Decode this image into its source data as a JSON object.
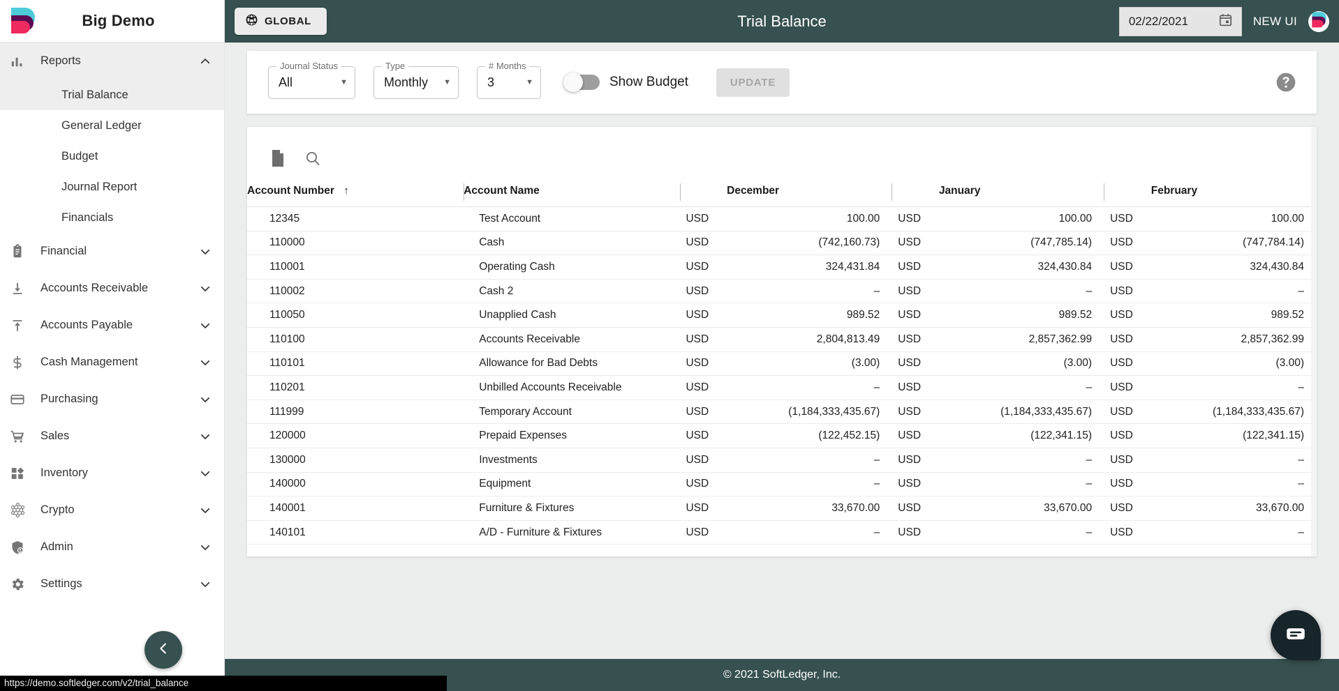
{
  "brand": {
    "title": "Big Demo",
    "logo_icon": "softledger-logo"
  },
  "sidebar": {
    "reports": {
      "label": "Reports",
      "icon": "bar-chart-icon",
      "chevron": "chevron-up-icon",
      "children": [
        {
          "label": "Trial Balance",
          "selected": true
        },
        {
          "label": "General Ledger",
          "selected": false
        },
        {
          "label": "Budget",
          "selected": false
        },
        {
          "label": "Journal Report",
          "selected": false
        },
        {
          "label": "Financials",
          "selected": false
        }
      ]
    },
    "items": [
      {
        "label": "Financial",
        "icon": "clipboard-icon"
      },
      {
        "label": "Accounts Receivable",
        "icon": "download-arrow-icon"
      },
      {
        "label": "Accounts Payable",
        "icon": "upload-arrow-icon"
      },
      {
        "label": "Cash Management",
        "icon": "dollar-sign-icon"
      },
      {
        "label": "Purchasing",
        "icon": "credit-card-icon"
      },
      {
        "label": "Sales",
        "icon": "shopping-cart-icon"
      },
      {
        "label": "Inventory",
        "icon": "grid-blocks-icon"
      },
      {
        "label": "Crypto",
        "icon": "crypto-network-icon"
      },
      {
        "label": "Admin",
        "icon": "shield-user-icon"
      },
      {
        "label": "Settings",
        "icon": "gear-icon"
      }
    ],
    "collapse_icon": "chevron-left-icon"
  },
  "statusbar": {
    "url": "https://demo.softledger.com/v2/trial_balance"
  },
  "topbar": {
    "global_label": "GLOBAL",
    "global_icon": "globe-icon",
    "page_title": "Trial Balance",
    "date_value": "02/22/2021",
    "calendar_icon": "calendar-icon",
    "new_ui_label": "NEW UI",
    "avatar_icon": "user-avatar-logo"
  },
  "filters": {
    "journal_status": {
      "legend": "Journal Status",
      "value": "All",
      "caret": "caret-down-icon"
    },
    "type": {
      "legend": "Type",
      "value": "Monthly",
      "caret": "caret-down-icon"
    },
    "months": {
      "legend": "# Months",
      "value": "3",
      "caret": "caret-down-icon"
    },
    "show_budget": {
      "label": "Show Budget",
      "on": false
    },
    "update_label": "UPDATE",
    "help_icon": "question-mark-circle-icon"
  },
  "table_tools": {
    "export_icon": "document-icon",
    "search_icon": "search-icon"
  },
  "table": {
    "headers": {
      "account_number": "Account Number",
      "account_name": "Account Name",
      "sort_arrow": "arrow-up-icon",
      "months": [
        "December",
        "January",
        "February"
      ]
    },
    "rows": [
      {
        "number": "12345",
        "name": "Test Account",
        "cur": "USD",
        "values": [
          "100.00",
          "100.00",
          "100.00"
        ]
      },
      {
        "number": "110000",
        "name": "Cash",
        "cur": "USD",
        "values": [
          "(742,160.73)",
          "(747,785.14)",
          "(747,784.14)"
        ]
      },
      {
        "number": "110001",
        "name": "Operating Cash",
        "cur": "USD",
        "values": [
          "324,431.84",
          "324,430.84",
          "324,430.84"
        ]
      },
      {
        "number": "110002",
        "name": "Cash 2",
        "cur": "USD",
        "values": [
          "–",
          "–",
          "–"
        ]
      },
      {
        "number": "110050",
        "name": "Unapplied Cash",
        "cur": "USD",
        "values": [
          "989.52",
          "989.52",
          "989.52"
        ]
      },
      {
        "number": "110100",
        "name": "Accounts Receivable",
        "cur": "USD",
        "values": [
          "2,804,813.49",
          "2,857,362.99",
          "2,857,362.99"
        ]
      },
      {
        "number": "110101",
        "name": "Allowance for Bad Debts",
        "cur": "USD",
        "values": [
          "(3.00)",
          "(3.00)",
          "(3.00)"
        ]
      },
      {
        "number": "110201",
        "name": "Unbilled Accounts Receivable",
        "cur": "USD",
        "values": [
          "–",
          "–",
          "–"
        ]
      },
      {
        "number": "111999",
        "name": "Temporary Account",
        "cur": "USD",
        "values": [
          "(1,184,333,435.67)",
          "(1,184,333,435.67)",
          "(1,184,333,435.67)"
        ]
      },
      {
        "number": "120000",
        "name": "Prepaid Expenses",
        "cur": "USD",
        "values": [
          "(122,452.15)",
          "(122,341.15)",
          "(122,341.15)"
        ]
      },
      {
        "number": "130000",
        "name": "Investments",
        "cur": "USD",
        "values": [
          "–",
          "–",
          "–"
        ]
      },
      {
        "number": "140000",
        "name": "Equipment",
        "cur": "USD",
        "values": [
          "–",
          "–",
          "–"
        ]
      },
      {
        "number": "140001",
        "name": "Furniture & Fixtures",
        "cur": "USD",
        "values": [
          "33,670.00",
          "33,670.00",
          "33,670.00"
        ]
      },
      {
        "number": "140101",
        "name": "A/D - Furniture & Fixtures",
        "cur": "USD",
        "values": [
          "–",
          "–",
          "–"
        ]
      }
    ]
  },
  "footer": {
    "copyright": "© 2021 SoftLedger, Inc."
  },
  "chat": {
    "icon": "chat-bubble-icon"
  },
  "colors": {
    "header_bg": "#36514f",
    "accent_link": "#2f6fab",
    "page_bg": "#eceded",
    "sidebar_active": "#eeeeee"
  }
}
